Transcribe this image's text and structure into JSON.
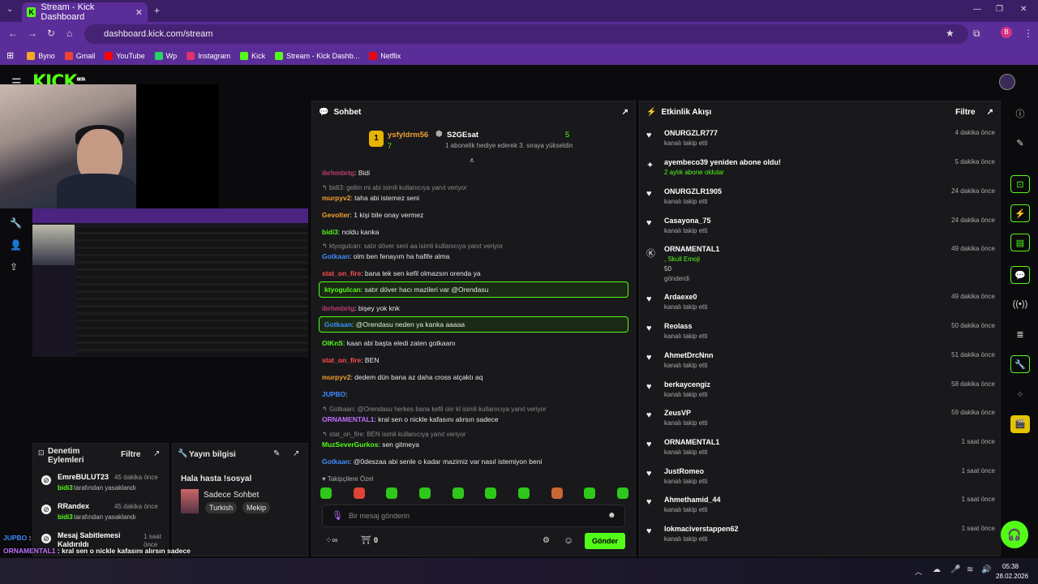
{
  "browser": {
    "tab_title": "Stream - Kick Dashboard",
    "url": "dashboard.kick.com/stream",
    "bookmarks": [
      {
        "label": "Byno",
        "color": "#f5a623"
      },
      {
        "label": "Gmail",
        "color": "#ea4335"
      },
      {
        "label": "YouTube",
        "color": "#ff0000"
      },
      {
        "label": "Wp",
        "color": "#25d366"
      },
      {
        "label": "Instagram",
        "color": "#e1306c"
      },
      {
        "label": "Kick",
        "color": "#53fc18"
      },
      {
        "label": "Stream - Kick Dashb...",
        "color": "#53fc18"
      },
      {
        "label": "Netflix",
        "color": "#e50914"
      }
    ],
    "profile_initial": "B"
  },
  "brand": {
    "logo": "KICK",
    "badge": "BETA",
    "accent": "#53fc18"
  },
  "chat": {
    "title": "Sohbet",
    "pinned": {
      "top_user": "ysfyldrm56",
      "top_rank": "1",
      "top_count": "7",
      "gifter": "S2GEsat",
      "gifter_count": "5",
      "gift_text": "1 abonelik hediye ederek 3. sıraya yükseldin"
    },
    "messages": [
      {
        "user": "ibrhmbrtg",
        "text": "Bidi",
        "color": "#c23d6b"
      },
      {
        "reply": "bidi3: gelim mi abi isimli kullanıcıya yanıt veriyor"
      },
      {
        "user": "murpyv2",
        "text": "taha abi istemez seni",
        "color": "#f0a030"
      },
      {
        "user": "Gevolter",
        "text": "1 kişi bile onay vermez",
        "color": "#f0a030"
      },
      {
        "user": "bidi3",
        "text": "noldu kanka",
        "color": "#53fc18"
      },
      {
        "reply": "ktyogulcan: satır döver seni aa isimli kullanıcıya yanıt veriyor"
      },
      {
        "user": "Gotkaan",
        "text": "olm ben fenayım ha hafife alma",
        "color": "#3f8cff"
      },
      {
        "user": "stat_on_fire",
        "text": "bana tek sen kefil olmazsın orenda ya",
        "color": "#ff4d4d"
      },
      {
        "user": "ktyogulcan",
        "text": "satır döver hacı mazileri var @Orendasu",
        "color": "#53fc18",
        "hl": true
      },
      {
        "user": "ibrhmbrtg",
        "text": "bişey yok knk",
        "color": "#c23d6b"
      },
      {
        "user": "Gotkaan",
        "text": "@Orendasu neden ya kanka aaaaa",
        "color": "#3f8cff",
        "hl": true
      },
      {
        "user": "OlKnS",
        "text": "kaan abi başta eledi zaten gotkaanı",
        "color": "#53fc18"
      },
      {
        "user": "stat_on_fire",
        "text": "BEN",
        "color": "#ff4d4d"
      },
      {
        "user": "murpyv2",
        "text": "dedem dün bana az daha cross atçaktı aq",
        "color": "#f0a030"
      },
      {
        "user": "JUPBO",
        "text": "",
        "color": "#3f8cff"
      },
      {
        "reply": "Gotkaan: @Orendasu herkes bana kefil olır kl isimli kullanıcıya yanıt veriyor"
      },
      {
        "user": "ORNAMENTAL1",
        "text": "kral sen o nickle kafasını alırsın sadece",
        "color": "#c070ff"
      },
      {
        "reply": "stat_on_fire: BEN isimli kullanıcıya yanıt veriyor"
      },
      {
        "user": "MuzSeverGurkos",
        "text": "sen gitmeya",
        "color": "#53fc18"
      },
      {
        "user": "Gotkaan",
        "text": "@0deszaa abi senle o kadar mazimiz var nasıl istemiyon beni",
        "color": "#3f8cff"
      }
    ],
    "emote_label": "Takipçilere Özel",
    "input_placeholder": "Bir mesaj gönderin",
    "points": "0",
    "send_label": "Gönder"
  },
  "activity": {
    "title": "Etkinlik Akışı",
    "filter": "Filtre",
    "items": [
      {
        "name": "ONURGZLR777",
        "sub": "kanalı takip etti",
        "time": "4 dakika önce",
        "icon": "heart"
      },
      {
        "name": "ayembeco39 yeniden abone oldu!",
        "sub": "2 aylık abone oldular",
        "time": "5 dakika önce",
        "icon": "star"
      },
      {
        "name": "ONURGZLR1905",
        "sub": "kanalı takip etti",
        "time": "24 dakika önce",
        "icon": "heart"
      },
      {
        "name": "Casayona_75",
        "sub": "kanalı takip etti",
        "time": "24 dakika önce",
        "icon": "heart"
      },
      {
        "name": "ORNAMENTAL1",
        "sub": ", Skull Emoji",
        "extra": "50",
        "extra2": "gönderdi",
        "time": "49 dakika önce",
        "icon": "kick"
      },
      {
        "name": "Ardaexe0",
        "sub": "kanalı takip etti",
        "time": "49 dakika önce",
        "icon": "heart"
      },
      {
        "name": "Reolass",
        "sub": "kanalı takip etti",
        "time": "50 dakika önce",
        "icon": "heart"
      },
      {
        "name": "AhmetDrcNnn",
        "sub": "kanalı takip etti",
        "time": "51 dakika önce",
        "icon": "heart"
      },
      {
        "name": "berkaycengiz",
        "sub": "kanalı takip etti",
        "time": "58 dakika önce",
        "icon": "heart"
      },
      {
        "name": "ZeusVP",
        "sub": "kanalı takip etti",
        "time": "59 dakika önce",
        "icon": "heart"
      },
      {
        "name": "ORNAMENTAL1",
        "sub": "kanalı takip etti",
        "time": "1 saat önce",
        "icon": "heart"
      },
      {
        "name": "JustRomeo",
        "sub": "kanalı takip etti",
        "time": "1 saat önce",
        "icon": "heart"
      },
      {
        "name": "Ahmethamid_44",
        "sub": "kanalı takip etti",
        "time": "1 saat önce",
        "icon": "heart"
      },
      {
        "name": "lokmaciverstappen62",
        "sub": "kanalı takip etti",
        "time": "1 saat önce",
        "icon": "heart"
      }
    ]
  },
  "moderation": {
    "title_line1": "Denetim",
    "title_line2": "Eylemleri",
    "filter": "Filtre",
    "items": [
      {
        "user": "EmreBULUT23",
        "time": "45 dakika önce",
        "by": "bidi3",
        "action": "tarafından yasaklandı"
      },
      {
        "user": "RRandex",
        "time": "45 dakika önce",
        "by": "bidi3",
        "action": "tarafından yasaklandı"
      },
      {
        "user": "Mesaj Sabitlemesi Kaldırıldı",
        "time": "1 saat önce"
      }
    ]
  },
  "stream_info": {
    "title": "Yayın bilgisi",
    "stream_title": "Hala hasta !sosyal",
    "category": "Sadece Sohbet",
    "tags": [
      "Turkish",
      "Mekip"
    ]
  },
  "overlay_chat": [
    {
      "user": "JUPBO",
      "text": ":",
      "color": "#3f8cff"
    },
    {
      "user": "ORNAMENTAL1",
      "text": ": kral sen o nickle kafasını alırsın sadece",
      "color": "#c070ff"
    },
    {
      "user": "MuzSeverGurkos",
      "text": ": sen gitmeya",
      "color": "#53fc18"
    },
    {
      "user": "Gotkaan",
      "text": ": @0deszaa abi senle o kadar mazimiz var nasıl istemiyon beni",
      "color": "#3f8cff"
    }
  ],
  "taskbar": {
    "time": "05:38",
    "date": "28.02.2026"
  }
}
